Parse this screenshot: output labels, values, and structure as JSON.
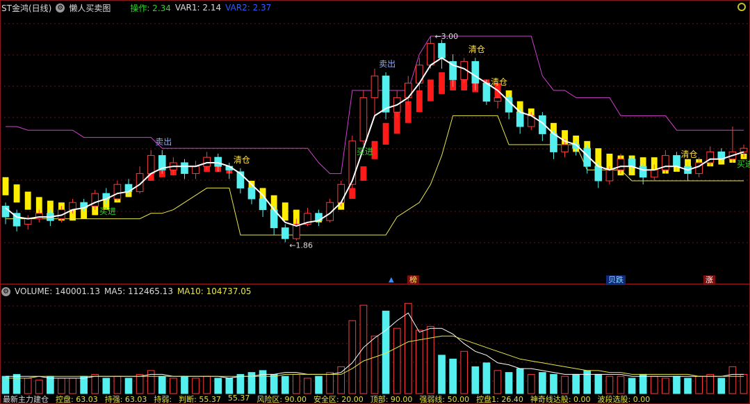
{
  "header": {
    "stock_name": "ST金鸿(日线)",
    "indicator_name": "懒人买卖图",
    "op_label": "操作: 2.34",
    "var1_label": "VAR1: 2.14",
    "var2_label": "VAR2: 2.37"
  },
  "volume_header": {
    "volume_label": "VOLUME: 140001.13",
    "ma5_label": "MA5: 112465.13",
    "ma10_label": "MA10: 104737.05"
  },
  "bottom_bar": {
    "items": [
      "最新主力建仓",
      "控盘: 63.03",
      "持强: 63.03",
      "持弱: ",
      "判断: 55.37",
      "55.37",
      "风险区: 90.00",
      "安全区: 20.00",
      "顶部: 90.00",
      "强弱线: 50.00",
      "控盘1: 26.40",
      "神奇线达股: 0.00",
      "波段选股: 0.00"
    ]
  },
  "tags": {
    "bang": "榜",
    "jidie": "贝跌",
    "zhang": "涨",
    "arrow": "▲"
  },
  "chart_data": {
    "type": "candlestick",
    "price_range": [
      1.7,
      3.1
    ],
    "annotations": {
      "high_label": "3.00",
      "low_label": "1.86",
      "signals": [
        {
          "text": "买进",
          "index": 9,
          "color": "#2cd62c"
        },
        {
          "text": "卖出",
          "index": 14,
          "color": "#8fa8ff"
        },
        {
          "text": "清仓",
          "index": 21,
          "color": "#ffe040"
        },
        {
          "text": "买进",
          "index": 32,
          "color": "#2cd62c"
        },
        {
          "text": "卖出",
          "index": 34,
          "color": "#8fa8ff"
        },
        {
          "text": "清仓",
          "index": 42,
          "color": "#ffe040"
        },
        {
          "text": "清仓",
          "index": 44,
          "color": "#ffe040"
        },
        {
          "text": "清仓",
          "index": 61,
          "color": "#ffe040"
        },
        {
          "text": "买进",
          "index": 66,
          "color": "#2cd62c"
        }
      ]
    },
    "candles": [
      [
        2.06,
        2.0,
        2.08,
        1.96
      ],
      [
        2.02,
        1.95,
        2.04,
        1.92
      ],
      [
        1.96,
        1.99,
        2.01,
        1.93
      ],
      [
        1.99,
        2.02,
        2.04,
        1.97
      ],
      [
        2.02,
        1.98,
        2.04,
        1.95
      ],
      [
        1.99,
        2.04,
        2.06,
        1.97
      ],
      [
        2.04,
        2.08,
        2.1,
        2.02
      ],
      [
        2.08,
        2.05,
        2.1,
        2.03
      ],
      [
        2.06,
        2.13,
        2.15,
        2.04
      ],
      [
        2.13,
        2.1,
        2.16,
        2.07
      ],
      [
        2.1,
        2.18,
        2.2,
        2.09
      ],
      [
        2.18,
        2.14,
        2.21,
        2.12
      ],
      [
        2.14,
        2.24,
        2.28,
        2.13
      ],
      [
        2.24,
        2.34,
        2.37,
        2.22
      ],
      [
        2.34,
        2.26,
        2.37,
        2.24
      ],
      [
        2.26,
        2.3,
        2.33,
        2.23
      ],
      [
        2.3,
        2.24,
        2.32,
        2.21
      ],
      [
        2.24,
        2.28,
        2.31,
        2.21
      ],
      [
        2.28,
        2.33,
        2.36,
        2.26
      ],
      [
        2.33,
        2.28,
        2.35,
        2.25
      ],
      [
        2.28,
        2.26,
        2.3,
        2.21
      ],
      [
        2.25,
        2.16,
        2.27,
        2.13
      ],
      [
        2.16,
        2.1,
        2.18,
        2.07
      ],
      [
        2.1,
        2.04,
        2.12,
        2.0
      ],
      [
        2.04,
        1.94,
        2.06,
        1.9
      ],
      [
        1.94,
        1.88,
        1.96,
        1.86
      ],
      [
        1.88,
        1.96,
        1.99,
        1.87
      ],
      [
        1.96,
        2.02,
        2.05,
        1.95
      ],
      [
        2.02,
        1.98,
        2.04,
        1.95
      ],
      [
        1.98,
        2.08,
        2.1,
        1.97
      ],
      [
        2.08,
        2.18,
        2.2,
        2.06
      ],
      [
        2.18,
        2.42,
        2.45,
        2.16
      ],
      [
        2.42,
        2.66,
        2.7,
        2.4
      ],
      [
        2.66,
        2.78,
        2.82,
        2.56
      ],
      [
        2.78,
        2.58,
        2.8,
        2.54
      ],
      [
        2.58,
        2.66,
        2.7,
        2.55
      ],
      [
        2.66,
        2.74,
        2.78,
        2.62
      ],
      [
        2.74,
        2.84,
        2.88,
        2.7
      ],
      [
        2.84,
        2.96,
        3.0,
        2.82
      ],
      [
        2.96,
        2.88,
        2.98,
        2.82
      ],
      [
        2.86,
        2.76,
        2.9,
        2.72
      ],
      [
        2.76,
        2.86,
        2.88,
        2.74
      ],
      [
        2.86,
        2.74,
        2.88,
        2.7
      ],
      [
        2.74,
        2.64,
        2.76,
        2.62
      ],
      [
        2.64,
        2.66,
        2.7,
        2.6
      ],
      [
        2.66,
        2.58,
        2.68,
        2.54
      ],
      [
        2.58,
        2.5,
        2.6,
        2.46
      ],
      [
        2.5,
        2.56,
        2.58,
        2.48
      ],
      [
        2.56,
        2.46,
        2.58,
        2.42
      ],
      [
        2.46,
        2.36,
        2.48,
        2.32
      ],
      [
        2.36,
        2.4,
        2.43,
        2.33
      ],
      [
        2.4,
        2.38,
        2.42,
        2.34
      ],
      [
        2.38,
        2.28,
        2.4,
        2.24
      ],
      [
        2.28,
        2.2,
        2.3,
        2.16
      ],
      [
        2.2,
        2.26,
        2.28,
        2.18
      ],
      [
        2.26,
        2.32,
        2.35,
        2.24
      ],
      [
        2.32,
        2.28,
        2.34,
        2.25
      ],
      [
        2.28,
        2.22,
        2.3,
        2.18
      ],
      [
        2.22,
        2.26,
        2.29,
        2.2
      ],
      [
        2.26,
        2.34,
        2.37,
        2.24
      ],
      [
        2.34,
        2.28,
        2.36,
        2.25
      ],
      [
        2.28,
        2.24,
        2.3,
        2.2
      ],
      [
        2.24,
        2.3,
        2.33,
        2.22
      ],
      [
        2.3,
        2.36,
        2.39,
        2.28
      ],
      [
        2.36,
        2.32,
        2.38,
        2.3
      ],
      [
        2.32,
        2.36,
        2.5,
        2.3
      ],
      [
        2.36,
        2.38,
        2.4,
        2.33
      ]
    ],
    "white_line": [
      2.05,
      2.0,
      1.99,
      2.0,
      2.0,
      2.01,
      2.04,
      2.05,
      2.08,
      2.1,
      2.13,
      2.14,
      2.18,
      2.24,
      2.27,
      2.28,
      2.28,
      2.28,
      2.3,
      2.3,
      2.28,
      2.24,
      2.18,
      2.12,
      2.04,
      1.97,
      1.95,
      1.97,
      1.98,
      2.02,
      2.08,
      2.2,
      2.38,
      2.56,
      2.6,
      2.62,
      2.66,
      2.74,
      2.84,
      2.88,
      2.84,
      2.82,
      2.78,
      2.74,
      2.7,
      2.64,
      2.58,
      2.56,
      2.52,
      2.46,
      2.42,
      2.4,
      2.34,
      2.28,
      2.26,
      2.28,
      2.28,
      2.26,
      2.26,
      2.28,
      2.28,
      2.26,
      2.28,
      2.32,
      2.32,
      2.34,
      2.36
    ],
    "ribbon_top": [
      2.22,
      2.18,
      2.14,
      2.11,
      2.09,
      2.08,
      2.07,
      2.07,
      2.08,
      2.1,
      2.13,
      2.16,
      2.2,
      2.26,
      2.28,
      2.29,
      2.28,
      2.28,
      2.29,
      2.29,
      2.28,
      2.24,
      2.2,
      2.16,
      2.12,
      2.08,
      2.04,
      2.02,
      2.02,
      2.04,
      2.08,
      2.16,
      2.28,
      2.42,
      2.52,
      2.58,
      2.64,
      2.7,
      2.76,
      2.8,
      2.8,
      2.8,
      2.78,
      2.76,
      2.74,
      2.7,
      2.64,
      2.6,
      2.56,
      2.52,
      2.48,
      2.45,
      2.42,
      2.38,
      2.35,
      2.34,
      2.34,
      2.33,
      2.33,
      2.33,
      2.33,
      2.32,
      2.32,
      2.33,
      2.33,
      2.34,
      2.35
    ],
    "ribbon_bottom": [
      2.12,
      2.08,
      2.04,
      2.01,
      1.99,
      1.98,
      1.98,
      1.99,
      2.01,
      2.04,
      2.08,
      2.11,
      2.15,
      2.2,
      2.22,
      2.23,
      2.24,
      2.25,
      2.25,
      2.25,
      2.24,
      2.2,
      2.14,
      2.08,
      2.02,
      1.98,
      1.96,
      1.96,
      1.97,
      2.0,
      2.04,
      2.1,
      2.2,
      2.32,
      2.4,
      2.46,
      2.52,
      2.58,
      2.64,
      2.68,
      2.7,
      2.7,
      2.69,
      2.68,
      2.66,
      2.62,
      2.58,
      2.55,
      2.5,
      2.44,
      2.4,
      2.36,
      2.32,
      2.27,
      2.24,
      2.23,
      2.23,
      2.23,
      2.23,
      2.24,
      2.25,
      2.25,
      2.26,
      2.28,
      2.29,
      2.3,
      2.32
    ],
    "ribbon_color": [
      "y",
      "y",
      "y",
      "y",
      "y",
      "y",
      "y",
      "y",
      "y",
      "y",
      "y",
      "y",
      "r",
      "r",
      "r",
      "r",
      "r",
      "r",
      "r",
      "r",
      "r",
      "y",
      "y",
      "y",
      "y",
      "y",
      "y",
      "y",
      "y",
      "y",
      "y",
      "r",
      "r",
      "r",
      "r",
      "r",
      "r",
      "r",
      "r",
      "r",
      "r",
      "r",
      "r",
      "r",
      "r",
      "y",
      "y",
      "y",
      "y",
      "y",
      "y",
      "y",
      "y",
      "y",
      "y",
      "y",
      "y",
      "y",
      "y",
      "y",
      "y",
      "y",
      "y",
      "y",
      "y",
      "y",
      "y"
    ],
    "magenta_line": [
      2.5,
      2.5,
      2.48,
      2.48,
      2.48,
      2.48,
      2.48,
      2.44,
      2.44,
      2.44,
      2.44,
      2.44,
      2.44,
      2.44,
      2.38,
      2.38,
      2.38,
      2.38,
      2.38,
      2.38,
      2.38,
      2.38,
      2.38,
      2.38,
      2.38,
      2.38,
      2.38,
      2.38,
      2.3,
      2.24,
      2.24,
      2.7,
      2.7,
      2.7,
      2.7,
      2.7,
      2.7,
      2.9,
      3.0,
      3.0,
      3.0,
      3.0,
      3.0,
      3.0,
      3.0,
      3.0,
      3.0,
      3.0,
      2.78,
      2.7,
      2.7,
      2.66,
      2.66,
      2.66,
      2.66,
      2.56,
      2.56,
      2.56,
      2.56,
      2.56,
      2.48,
      2.48,
      2.48,
      2.48,
      2.48,
      2.48,
      2.48
    ],
    "yellow_line": [
      1.99,
      1.99,
      1.99,
      1.99,
      1.99,
      1.99,
      1.99,
      1.99,
      1.99,
      1.99,
      1.99,
      1.99,
      1.99,
      2.02,
      2.02,
      2.04,
      2.08,
      2.12,
      2.16,
      2.16,
      2.16,
      1.9,
      1.9,
      1.9,
      1.9,
      1.9,
      1.9,
      1.9,
      1.9,
      1.9,
      1.9,
      1.9,
      1.9,
      1.9,
      1.9,
      2.0,
      2.04,
      2.08,
      2.18,
      2.34,
      2.56,
      2.56,
      2.56,
      2.56,
      2.56,
      2.4,
      2.4,
      2.4,
      2.4,
      2.4,
      2.4,
      2.4,
      2.26,
      2.26,
      2.26,
      2.26,
      2.2,
      2.2,
      2.2,
      2.2,
      2.2,
      2.2,
      2.2,
      2.2,
      2.2,
      2.2,
      2.2
    ],
    "volume": [
      9,
      10,
      8,
      7,
      9,
      8,
      8,
      9,
      10,
      8,
      9,
      8,
      10,
      12,
      9,
      8,
      9,
      8,
      9,
      8,
      8,
      10,
      11,
      12,
      10,
      9,
      10,
      8,
      9,
      11,
      14,
      38,
      46,
      30,
      43,
      34,
      47,
      33,
      35,
      20,
      18,
      22,
      14,
      16,
      12,
      11,
      13,
      10,
      11,
      10,
      9,
      10,
      12,
      10,
      9,
      9,
      8,
      10,
      9,
      8,
      9,
      8,
      9,
      10,
      8,
      14,
      10
    ],
    "volume_max": 50,
    "ma5_vol": [
      9,
      9,
      9,
      9,
      8,
      8,
      8,
      8,
      9,
      9,
      9,
      9,
      9,
      10,
      10,
      9,
      9,
      9,
      9,
      9,
      8,
      9,
      9,
      10,
      10,
      11,
      11,
      10,
      10,
      10,
      11,
      16,
      24,
      29,
      33,
      38,
      42,
      32,
      34,
      34,
      31,
      26,
      22,
      20,
      16,
      15,
      13,
      13,
      12,
      11,
      10,
      10,
      10,
      10,
      10,
      10,
      9,
      9,
      9,
      9,
      9,
      9,
      9,
      9,
      9,
      10,
      10
    ],
    "ma10_vol": [
      8,
      8,
      8,
      9,
      9,
      9,
      9,
      9,
      9,
      9,
      9,
      9,
      9,
      9,
      9,
      9,
      9,
      9,
      9,
      9,
      9,
      9,
      9,
      9,
      9,
      10,
      10,
      10,
      10,
      10,
      10,
      13,
      17,
      19,
      21,
      24,
      27,
      28,
      29,
      30,
      30,
      28,
      26,
      24,
      22,
      20,
      18,
      17,
      16,
      15,
      14,
      13,
      12,
      12,
      11,
      11,
      10,
      10,
      10,
      10,
      10,
      10,
      9,
      9,
      9,
      9,
      9
    ]
  }
}
